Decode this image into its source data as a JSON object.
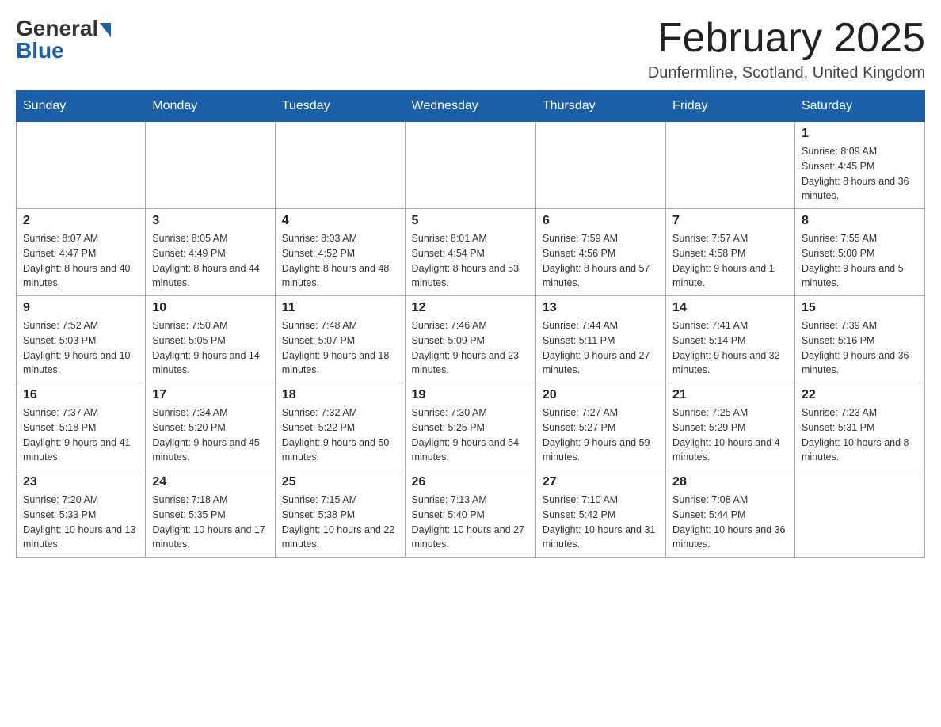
{
  "header": {
    "logo": {
      "general": "General",
      "blue": "Blue"
    },
    "title": "February 2025",
    "location": "Dunfermline, Scotland, United Kingdom"
  },
  "days_of_week": [
    "Sunday",
    "Monday",
    "Tuesday",
    "Wednesday",
    "Thursday",
    "Friday",
    "Saturday"
  ],
  "weeks": [
    [
      {
        "day": "",
        "info": ""
      },
      {
        "day": "",
        "info": ""
      },
      {
        "day": "",
        "info": ""
      },
      {
        "day": "",
        "info": ""
      },
      {
        "day": "",
        "info": ""
      },
      {
        "day": "",
        "info": ""
      },
      {
        "day": "1",
        "info": "Sunrise: 8:09 AM\nSunset: 4:45 PM\nDaylight: 8 hours and 36 minutes."
      }
    ],
    [
      {
        "day": "2",
        "info": "Sunrise: 8:07 AM\nSunset: 4:47 PM\nDaylight: 8 hours and 40 minutes."
      },
      {
        "day": "3",
        "info": "Sunrise: 8:05 AM\nSunset: 4:49 PM\nDaylight: 8 hours and 44 minutes."
      },
      {
        "day": "4",
        "info": "Sunrise: 8:03 AM\nSunset: 4:52 PM\nDaylight: 8 hours and 48 minutes."
      },
      {
        "day": "5",
        "info": "Sunrise: 8:01 AM\nSunset: 4:54 PM\nDaylight: 8 hours and 53 minutes."
      },
      {
        "day": "6",
        "info": "Sunrise: 7:59 AM\nSunset: 4:56 PM\nDaylight: 8 hours and 57 minutes."
      },
      {
        "day": "7",
        "info": "Sunrise: 7:57 AM\nSunset: 4:58 PM\nDaylight: 9 hours and 1 minute."
      },
      {
        "day": "8",
        "info": "Sunrise: 7:55 AM\nSunset: 5:00 PM\nDaylight: 9 hours and 5 minutes."
      }
    ],
    [
      {
        "day": "9",
        "info": "Sunrise: 7:52 AM\nSunset: 5:03 PM\nDaylight: 9 hours and 10 minutes."
      },
      {
        "day": "10",
        "info": "Sunrise: 7:50 AM\nSunset: 5:05 PM\nDaylight: 9 hours and 14 minutes."
      },
      {
        "day": "11",
        "info": "Sunrise: 7:48 AM\nSunset: 5:07 PM\nDaylight: 9 hours and 18 minutes."
      },
      {
        "day": "12",
        "info": "Sunrise: 7:46 AM\nSunset: 5:09 PM\nDaylight: 9 hours and 23 minutes."
      },
      {
        "day": "13",
        "info": "Sunrise: 7:44 AM\nSunset: 5:11 PM\nDaylight: 9 hours and 27 minutes."
      },
      {
        "day": "14",
        "info": "Sunrise: 7:41 AM\nSunset: 5:14 PM\nDaylight: 9 hours and 32 minutes."
      },
      {
        "day": "15",
        "info": "Sunrise: 7:39 AM\nSunset: 5:16 PM\nDaylight: 9 hours and 36 minutes."
      }
    ],
    [
      {
        "day": "16",
        "info": "Sunrise: 7:37 AM\nSunset: 5:18 PM\nDaylight: 9 hours and 41 minutes."
      },
      {
        "day": "17",
        "info": "Sunrise: 7:34 AM\nSunset: 5:20 PM\nDaylight: 9 hours and 45 minutes."
      },
      {
        "day": "18",
        "info": "Sunrise: 7:32 AM\nSunset: 5:22 PM\nDaylight: 9 hours and 50 minutes."
      },
      {
        "day": "19",
        "info": "Sunrise: 7:30 AM\nSunset: 5:25 PM\nDaylight: 9 hours and 54 minutes."
      },
      {
        "day": "20",
        "info": "Sunrise: 7:27 AM\nSunset: 5:27 PM\nDaylight: 9 hours and 59 minutes."
      },
      {
        "day": "21",
        "info": "Sunrise: 7:25 AM\nSunset: 5:29 PM\nDaylight: 10 hours and 4 minutes."
      },
      {
        "day": "22",
        "info": "Sunrise: 7:23 AM\nSunset: 5:31 PM\nDaylight: 10 hours and 8 minutes."
      }
    ],
    [
      {
        "day": "23",
        "info": "Sunrise: 7:20 AM\nSunset: 5:33 PM\nDaylight: 10 hours and 13 minutes."
      },
      {
        "day": "24",
        "info": "Sunrise: 7:18 AM\nSunset: 5:35 PM\nDaylight: 10 hours and 17 minutes."
      },
      {
        "day": "25",
        "info": "Sunrise: 7:15 AM\nSunset: 5:38 PM\nDaylight: 10 hours and 22 minutes."
      },
      {
        "day": "26",
        "info": "Sunrise: 7:13 AM\nSunset: 5:40 PM\nDaylight: 10 hours and 27 minutes."
      },
      {
        "day": "27",
        "info": "Sunrise: 7:10 AM\nSunset: 5:42 PM\nDaylight: 10 hours and 31 minutes."
      },
      {
        "day": "28",
        "info": "Sunrise: 7:08 AM\nSunset: 5:44 PM\nDaylight: 10 hours and 36 minutes."
      },
      {
        "day": "",
        "info": ""
      }
    ]
  ]
}
